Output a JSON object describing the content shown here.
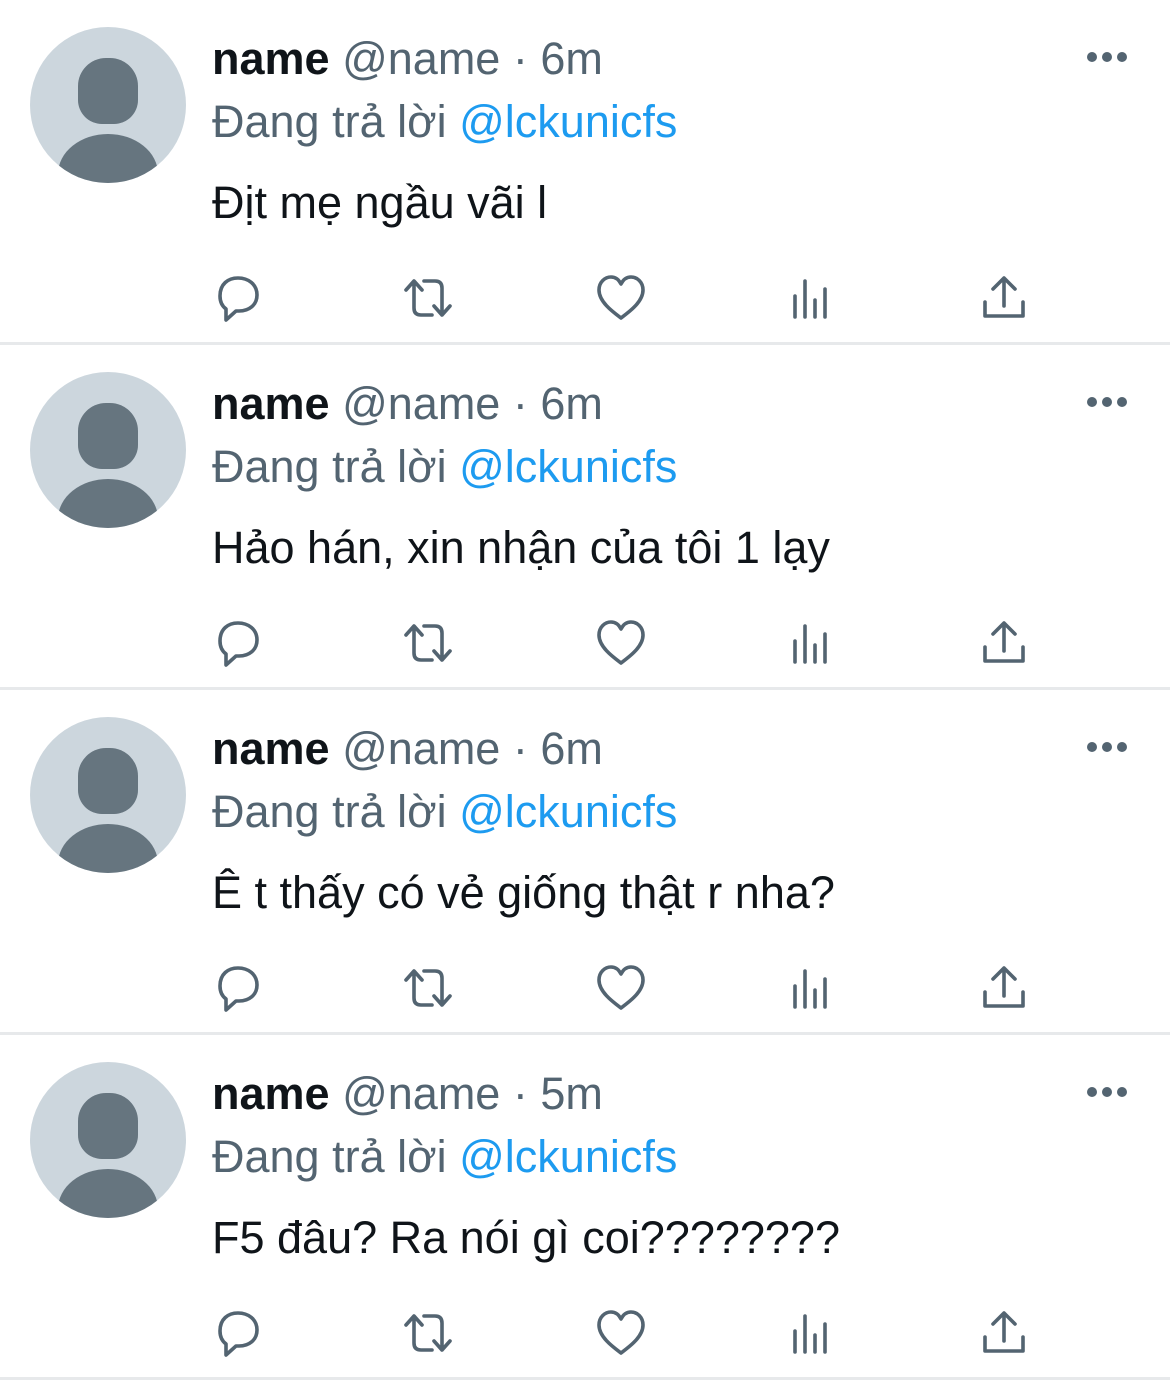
{
  "colors": {
    "text_primary": "#0f1419",
    "text_secondary": "#536471",
    "link": "#1d9bf0",
    "avatar_bg": "#ccd6dd",
    "avatar_fg": "#66757f",
    "divider": "#e7e9eb"
  },
  "icons": {
    "more": "more-horizontal-icon",
    "reply": "reply-icon",
    "retweet": "retweet-icon",
    "like": "heart-icon",
    "views": "views-icon",
    "share": "share-icon"
  },
  "tweets": [
    {
      "display_name": "name",
      "handle": "@name",
      "separator": "·",
      "time": "6m",
      "reply_prefix": "Đang trả lời",
      "reply_to": "@lckunicfs",
      "text": "Địt mẹ ngầu vãi l"
    },
    {
      "display_name": "name",
      "handle": "@name",
      "separator": "·",
      "time": "6m",
      "reply_prefix": "Đang trả lời",
      "reply_to": "@lckunicfs",
      "text": "Hảo hán, xin nhận của tôi 1 lạy"
    },
    {
      "display_name": "name",
      "handle": "@name",
      "separator": "·",
      "time": "6m",
      "reply_prefix": "Đang trả lời",
      "reply_to": "@lckunicfs",
      "text": "Ê t thấy có vẻ giống thật r nha?"
    },
    {
      "display_name": "name",
      "handle": "@name",
      "separator": "·",
      "time": "5m",
      "reply_prefix": "Đang trả lời",
      "reply_to": "@lckunicfs",
      "text": "F5 đâu? Ra nói gì coi????????"
    }
  ]
}
